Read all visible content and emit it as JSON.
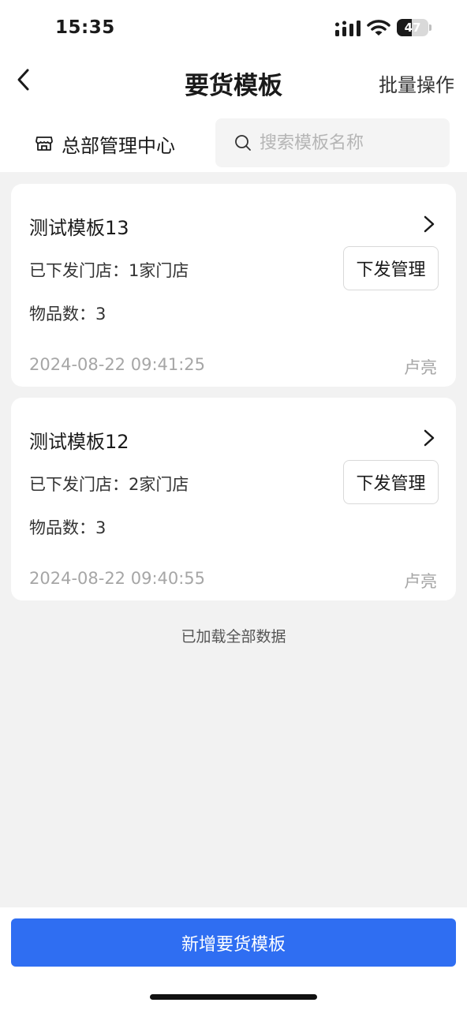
{
  "status_bar": {
    "time": "15:35",
    "battery": "47",
    "battery_level": 0.47
  },
  "nav": {
    "title": "要货模板",
    "right_action": "批量操作",
    "back_icon": "chevron-left-icon"
  },
  "filter": {
    "store_name": "总部管理中心",
    "store_icon": "store-icon",
    "search_placeholder": "搜索模板名称",
    "search_icon": "search-icon"
  },
  "templates": [
    {
      "title": "测试模板13",
      "stores": "已下发门店：1家门店",
      "items": "物品数：3",
      "date": "2024-08-22 09:41:25",
      "owner": "卢亮",
      "action": "下发管理"
    },
    {
      "title": "测试模板12",
      "stores": "已下发门店：2家门店",
      "items": "物品数：3",
      "date": "2024-08-22 09:40:55",
      "owner": "卢亮",
      "action": "下发管理"
    }
  ],
  "list_footer": "已加载全部数据",
  "bottom": {
    "add_button": "新增要货模板"
  },
  "colors": {
    "primary": "#2f6ef2",
    "background": "#f2f2f2",
    "muted_text": "#a6a6a6"
  }
}
